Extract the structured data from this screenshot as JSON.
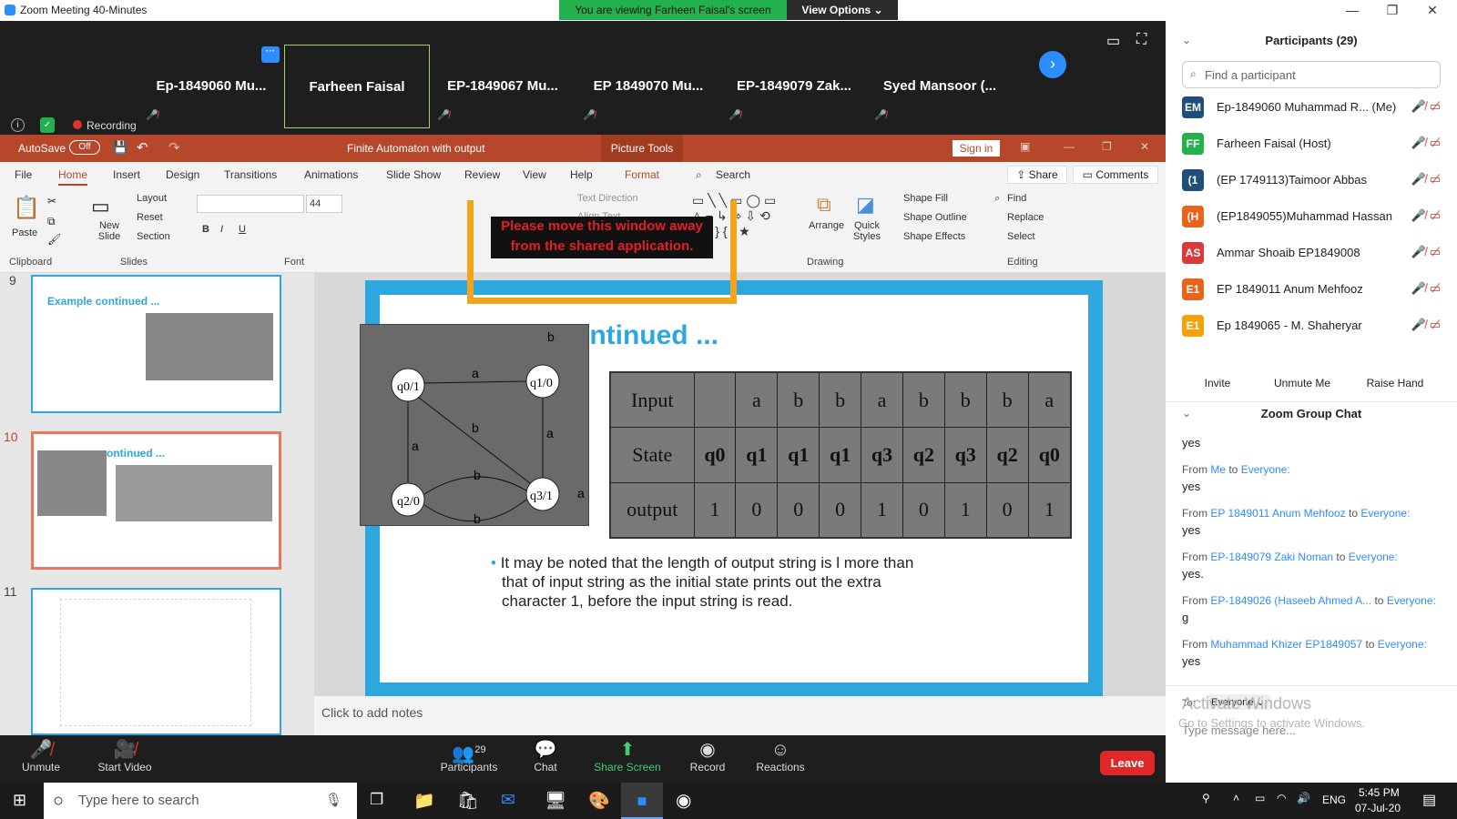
{
  "window": {
    "title": "Zoom Meeting 40-Minutes",
    "min": "—",
    "max": "❐",
    "close": "✕"
  },
  "share_banner": {
    "text": "You are viewing Farheen Faisal's screen",
    "view_options": "View Options"
  },
  "videos": [
    {
      "name": "Ep-1849060 Mu..."
    },
    {
      "name": "Farheen Faisal"
    },
    {
      "name": "EP-1849067 Mu..."
    },
    {
      "name": "EP 1849070 Mu..."
    },
    {
      "name": "EP-1849079 Zak..."
    },
    {
      "name": "Syed Mansoor (..."
    }
  ],
  "recording_label": "Recording",
  "ppt": {
    "autosave": "AutoSave",
    "autosave_state": "Off",
    "doc_title": "Finite Automaton with output",
    "context_tab": "Picture Tools",
    "sign_in": "Sign in",
    "tabs": [
      "File",
      "Home",
      "Insert",
      "Design",
      "Transitions",
      "Animations",
      "Slide Show",
      "Review",
      "View",
      "Help",
      "Format"
    ],
    "search": "Search",
    "share": "Share",
    "comments": "Comments",
    "ribbon": {
      "paste": "Paste",
      "new_slide": "New Slide",
      "layout": "Layout",
      "reset": "Reset",
      "section": "Section",
      "font_size": "44",
      "text_direction": "Text Direction",
      "align_text": "Align Text",
      "arrange": "Arrange",
      "quick_styles": "Quick Styles",
      "shape_fill": "Shape Fill",
      "shape_outline": "Shape Outline",
      "shape_effects": "Shape Effects",
      "find": "Find",
      "replace": "Replace",
      "select": "Select"
    },
    "groups": {
      "clipboard": "Clipboard",
      "slides": "Slides",
      "font": "Font",
      "drawing": "Drawing",
      "editing": "Editing"
    },
    "warning": [
      "Please move this window away",
      "from the shared application."
    ],
    "thumbs": [
      {
        "num": "9",
        "title": "Example continued ..."
      },
      {
        "num": "10",
        "title": "ontinued ..."
      },
      {
        "num": "11",
        "title": ""
      }
    ],
    "slide": {
      "title": "ontinued ...",
      "table": {
        "rows": [
          {
            "label": "Input",
            "cells": [
              "",
              "a",
              "b",
              "b",
              "a",
              "b",
              "b",
              "b",
              "a"
            ]
          },
          {
            "label": "State",
            "cells": [
              "q0",
              "q1",
              "q1",
              "q1",
              "q3",
              "q2",
              "q3",
              "q2",
              "q0"
            ]
          },
          {
            "label": "output",
            "cells": [
              "1",
              "0",
              "0",
              "0",
              "1",
              "0",
              "1",
              "0",
              "1"
            ]
          }
        ]
      },
      "automaton": {
        "states": [
          "q0/1",
          "q1/0",
          "q2/0",
          "q3/1"
        ],
        "edge_labels": [
          "a",
          "b",
          "a",
          "a",
          "b",
          "b",
          "b",
          "a"
        ]
      },
      "bullet": [
        "It may be noted that the length of output string is l more than",
        "that of input string as the initial state prints out the extra",
        "character 1, before the input string is read."
      ]
    },
    "notes": "Click to add notes"
  },
  "controls": {
    "unmute": "Unmute",
    "start_video": "Start Video",
    "participants": "Participants",
    "participants_count": "29",
    "chat": "Chat",
    "share_screen": "Share Screen",
    "record": "Record",
    "reactions": "Reactions",
    "leave": "Leave"
  },
  "taskbar": {
    "search": "Type here to search",
    "lang": "ENG",
    "time": "5:45 PM",
    "date": "07-Jul-20"
  },
  "panel": {
    "participants_title": "Participants (29)",
    "find_placeholder": "Find a participant",
    "participants": [
      {
        "initials": "EM",
        "name": "Ep-1849060 Muhammad R... (Me)",
        "color": "#1f4e79"
      },
      {
        "initials": "FF",
        "name": "Farheen Faisal (Host)",
        "color": "#22b14c"
      },
      {
        "initials": "(1",
        "name": "(EP 1749113)Taimoor Abbas",
        "color": "#1f4e79"
      },
      {
        "initials": "(H",
        "name": "(EP1849055)Muhammad Hassan",
        "color": "#e8641b"
      },
      {
        "initials": "AS",
        "name": "Ammar Shoaib EP1849008",
        "color": "#d93b3b"
      },
      {
        "initials": "E1",
        "name": "EP 1849011 Anum Mehfooz",
        "color": "#e8641b"
      },
      {
        "initials": "E1",
        "name": "Ep 1849065 - M. Shaheryar",
        "color": "#f2a20c"
      }
    ],
    "invite": "Invite",
    "unmute_me": "Unmute Me",
    "raise_hand": "Raise Hand",
    "chat_title": "Zoom Group Chat",
    "chat": [
      {
        "from": "",
        "to": "",
        "text": "yes"
      },
      {
        "from": "Me",
        "to": "Everyone:",
        "text": "yes"
      },
      {
        "from": "EP 1849011 Anum Mehfooz",
        "to": "Everyone:",
        "text": "yes"
      },
      {
        "from": "EP-1849079 Zaki Noman",
        "to": "Everyone:",
        "text": "yes."
      },
      {
        "from": "EP-1849026 (Haseeb Ahmed A...",
        "to": "Everyone:",
        "text": "g"
      },
      {
        "from": "Muhammad Khizer EP1849057",
        "to": "Everyone:",
        "text": "yes"
      }
    ],
    "to_label": "To:",
    "to_value": "Everyone",
    "message_placeholder": "Type message here...",
    "watermark": [
      "Activate Windows",
      "Go to Settings to activate Windows."
    ]
  }
}
